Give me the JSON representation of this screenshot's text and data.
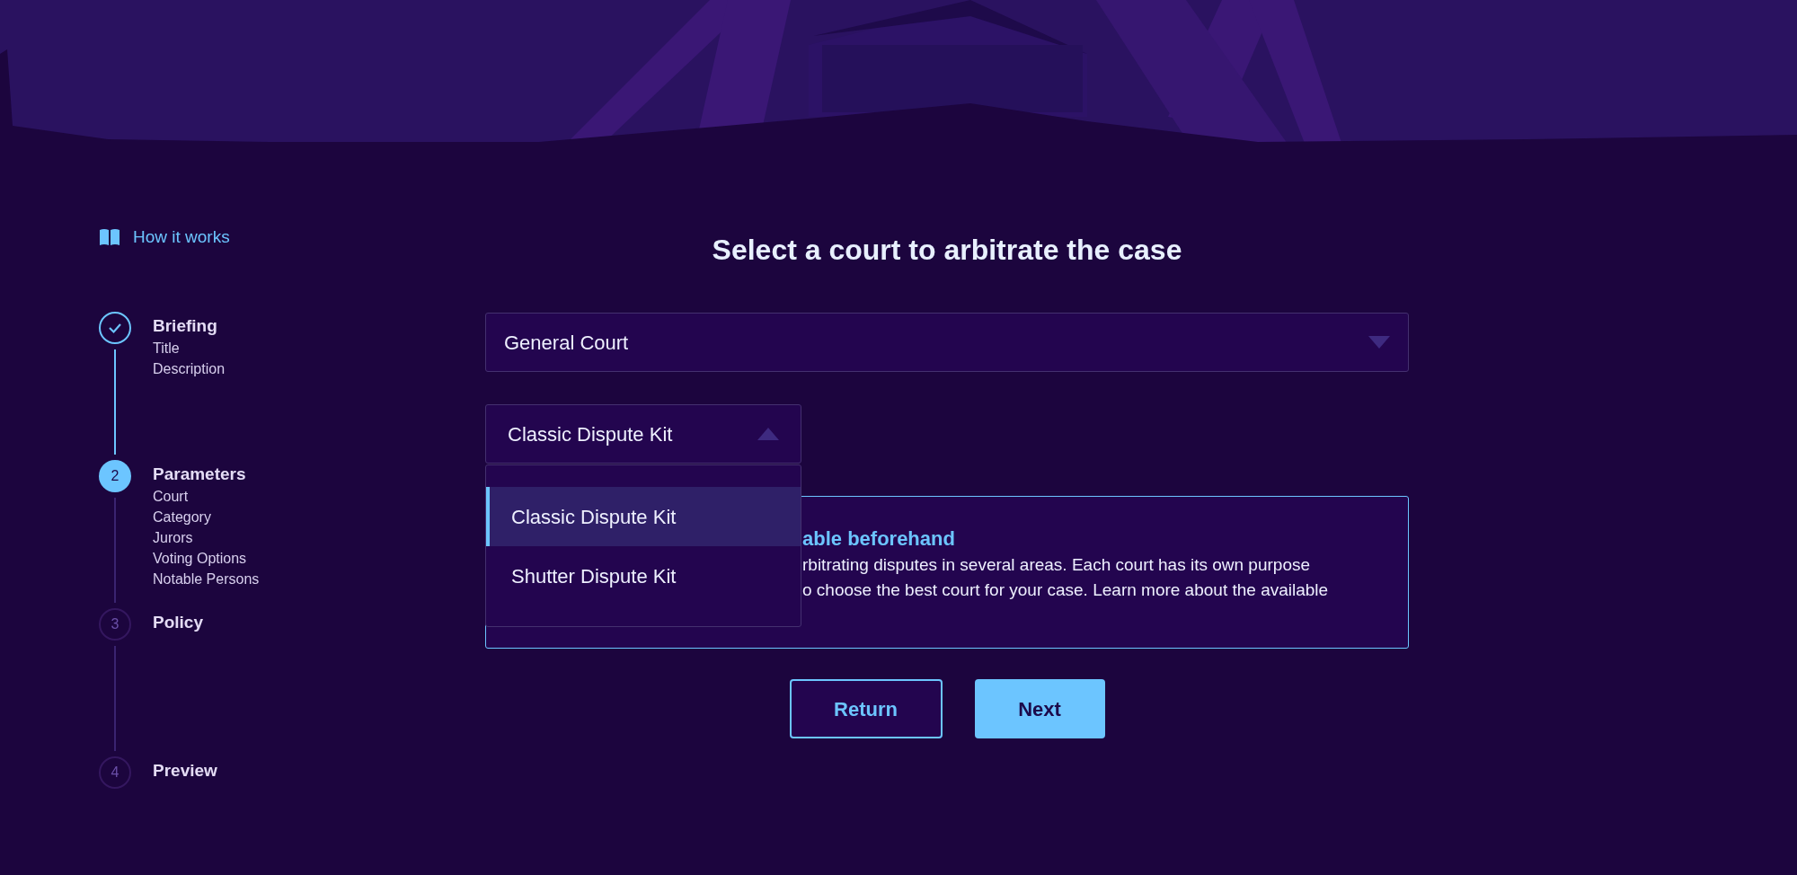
{
  "help_link": {
    "label": "How it works"
  },
  "steps": [
    {
      "kind": "done",
      "title": "Briefing",
      "items": [
        "Title",
        "Description"
      ]
    },
    {
      "number": "2",
      "kind": "current",
      "title": "Parameters",
      "items": [
        "Court",
        "Category",
        "Jurors",
        "Voting Options",
        "Notable Persons"
      ]
    },
    {
      "number": "3",
      "kind": "pending",
      "title": "Policy"
    },
    {
      "number": "4",
      "kind": "pending",
      "title": "Preview"
    }
  ],
  "heading": "Select a court to arbitrate the case",
  "court_select": {
    "value": "General Court",
    "expanded": false
  },
  "kit_select": {
    "value": "Classic Dispute Kit",
    "expanded": true,
    "options": [
      {
        "label": "Classic Dispute Kit",
        "selected": true
      },
      {
        "label": "Shutter Dispute Kit",
        "selected": false
      }
    ]
  },
  "info_box": {
    "title": "able beforehand",
    "lines": [
      "rbitrating disputes in several areas. Each court has its own purpose",
      "o choose the best court for your case. Learn more about the available"
    ]
  },
  "buttons": [
    {
      "label": "Return",
      "kind": "secondary"
    },
    {
      "label": "Next",
      "kind": "primary"
    }
  ]
}
